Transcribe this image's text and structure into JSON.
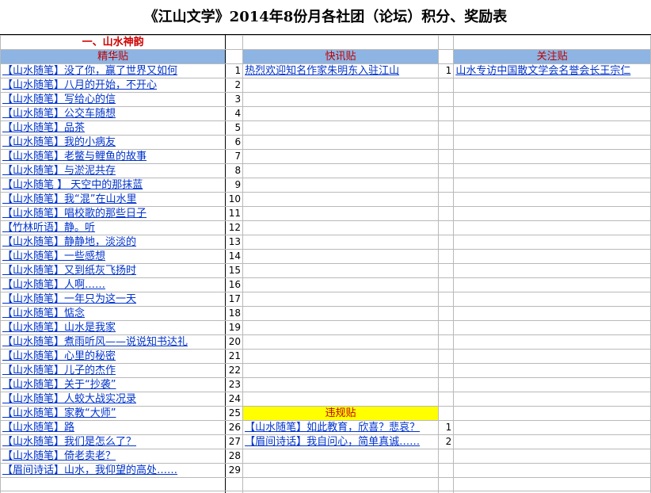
{
  "title": "《江山文学》2014年8份月各社团（论坛）积分、奖励表",
  "section_title": "一、山水神韵",
  "headers": {
    "jinghua": "精华贴",
    "kuaixun": "快讯贴",
    "guanzhu": "关注贴",
    "weigui": "违规贴"
  },
  "jinghua_posts": [
    {
      "title": "【山水随笔】没了你，赢了世界又如何",
      "n": "1"
    },
    {
      "title": "【山水随笔】八月的开始，不开心",
      "n": "2"
    },
    {
      "title": "【山水随笔】写给心的信",
      "n": "3"
    },
    {
      "title": "【山水随笔】公交车随想",
      "n": "4"
    },
    {
      "title": "【山水随笔】品茶",
      "n": "5"
    },
    {
      "title": "【山水随笔】我的小病友",
      "n": "6"
    },
    {
      "title": "【山水随笔】老鳖与鲤鱼的故事",
      "n": "7"
    },
    {
      "title": "【山水随笔】与淤泥共存",
      "n": "8"
    },
    {
      "title": "【山水随笔 】 天空中的那抹蓝",
      "n": "9"
    },
    {
      "title": "【山水随笔】我“混”在山水里",
      "n": "10"
    },
    {
      "title": "【山水随笔】唱校歌的那些日子",
      "n": "11"
    },
    {
      "title": "【竹林听语】静。听",
      "n": "12"
    },
    {
      "title": "【山水随笔】静静地，淡淡的",
      "n": "13"
    },
    {
      "title": "【山水随笔】一些感想",
      "n": "14"
    },
    {
      "title": "【山水随笔】又到纸灰飞扬时",
      "n": "15"
    },
    {
      "title": "【山水随笔】人啊……",
      "n": "16"
    },
    {
      "title": "【山水随笔】一年只为这一天",
      "n": "17"
    },
    {
      "title": "【山水随笔】惦念",
      "n": "18"
    },
    {
      "title": "【山水随笔】山水是我家",
      "n": "19"
    },
    {
      "title": "【山水随笔】煮雨听风——说说知书达礼",
      "n": "20"
    },
    {
      "title": "【山水随笔】心里的秘密",
      "n": "21"
    },
    {
      "title": "【山水随笔】儿子的杰作",
      "n": "22"
    },
    {
      "title": "【山水随笔】关于“抄袭”",
      "n": "23"
    },
    {
      "title": "【山水随笔】人蛟大战实况录",
      "n": "24"
    },
    {
      "title": "【山水随笔】家教“大师”",
      "n": "25"
    },
    {
      "title": "【山水随笔】路",
      "n": "26"
    },
    {
      "title": "【山水随笔】我们是怎么了？",
      "n": "27"
    },
    {
      "title": "【山水随笔】倚老卖老？",
      "n": "28"
    },
    {
      "title": "【眉间诗话】山水，我仰望的高处……",
      "n": "29"
    }
  ],
  "kuaixun_posts": [
    {
      "title": "热烈欢迎知名作家朱明东入驻江山",
      "n": "1"
    }
  ],
  "guanzhu_posts": [
    {
      "title": "山水专访中国散文学会名誉会长王宗仁"
    }
  ],
  "weigui_posts": [
    {
      "title": "【山水随笔】如此教育，欣喜？悲哀？",
      "n": "1"
    },
    {
      "title": "【眉间诗话】我自问心，简单真诚……",
      "n": "2"
    }
  ]
}
